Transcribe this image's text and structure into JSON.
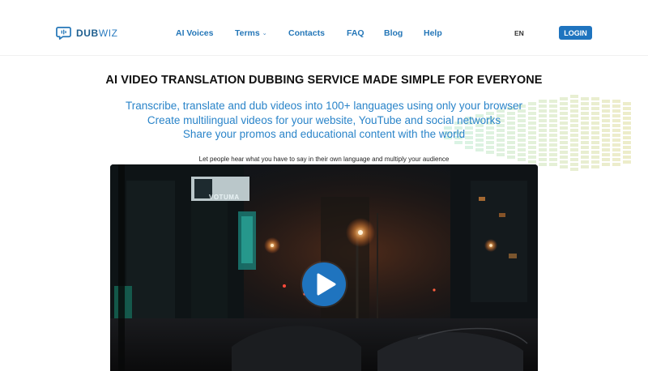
{
  "brand": {
    "name_bold": "DUB",
    "name_light": "WIZ"
  },
  "nav": {
    "links": [
      {
        "label": "AI Voices"
      },
      {
        "label": "Terms"
      },
      {
        "label": "Contacts"
      },
      {
        "label": "FAQ"
      },
      {
        "label": "Blog"
      },
      {
        "label": "Help"
      }
    ],
    "language": "EN",
    "login_label": "LOGIN"
  },
  "hero": {
    "title": "AI VIDEO TRANSLATION DUBBING SERVICE MADE SIMPLE FOR EVERYONE",
    "lines": [
      "Transcribe, translate and dub videos into 100+ languages using only your browser",
      "Create multilingual videos for your website, YouTube and social networks",
      "Share your promos and educational content with the world"
    ],
    "tagline": "Let people hear what you have to say in their own language and multiply your audience"
  },
  "video": {
    "sign_text": "VOTUMA"
  },
  "colors": {
    "accent": "#1f74bf",
    "link": "#2577b8",
    "hero_text": "#2a84c9"
  }
}
